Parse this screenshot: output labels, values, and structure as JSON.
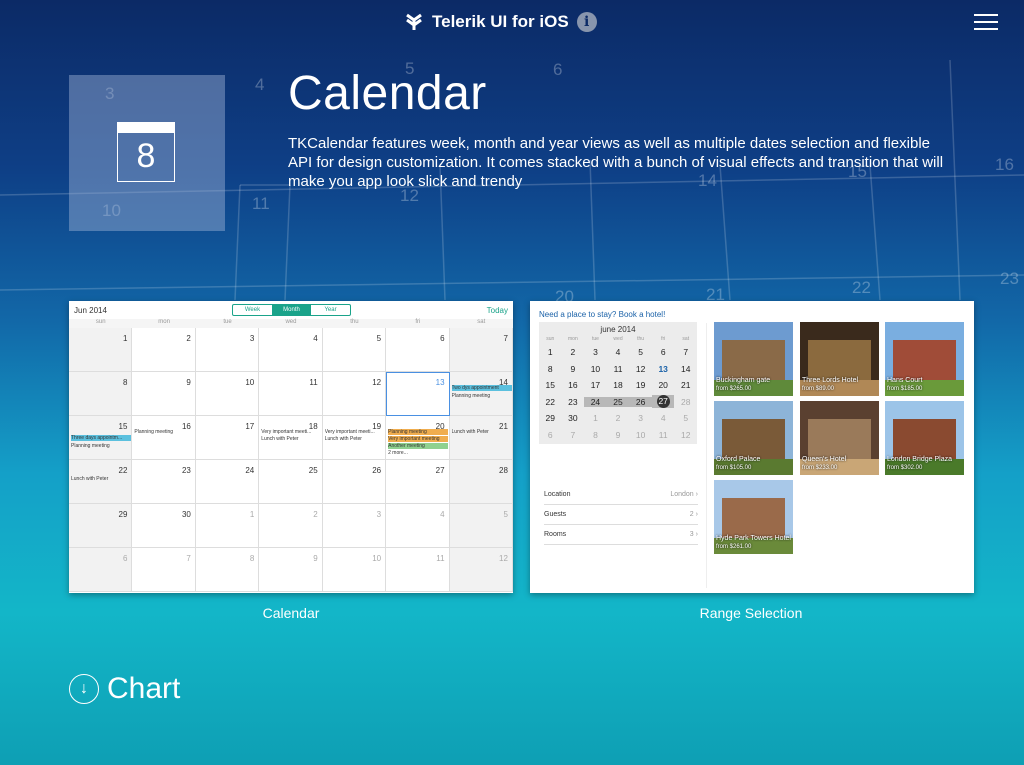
{
  "header": {
    "title": "Telerik UI for iOS",
    "info_glyph": "i"
  },
  "hero": {
    "icon_day": "8",
    "title": "Calendar",
    "description": "TKCalendar features week, month and year views as well as multiple dates selection and flexible API for design customization. It comes stacked with a bunch of visual effects and transition that will make you app look slick and trendy"
  },
  "bg_numbers": [
    "3",
    "4",
    "5",
    "6",
    "10",
    "11",
    "12",
    "14",
    "15",
    "16",
    "21",
    "22",
    "23",
    "20"
  ],
  "month_calendar": {
    "title": "Jun 2014",
    "views": [
      "Week",
      "Month",
      "Year"
    ],
    "active_view": "Month",
    "today_label": "Today",
    "dows": [
      "sun",
      "mon",
      "tue",
      "wed",
      "thu",
      "fri",
      "sat"
    ],
    "weeks": [
      [
        "1",
        "2",
        "3",
        "4",
        "5",
        "6",
        "7"
      ],
      [
        "8",
        "9",
        "10",
        "11",
        "12",
        "13",
        "14"
      ],
      [
        "15",
        "16",
        "17",
        "18",
        "19",
        "20",
        "21"
      ],
      [
        "22",
        "23",
        "24",
        "25",
        "26",
        "27",
        "28"
      ],
      [
        "29",
        "30",
        "1",
        "2",
        "3",
        "4",
        "5"
      ],
      [
        "6",
        "7",
        "8",
        "9",
        "10",
        "11",
        "12"
      ]
    ],
    "events": {
      "two_days": "Two dys appointment",
      "planning": "Planning meeting",
      "three_days": "Three days appointm...",
      "very_important": "Very important meeti...",
      "lunch": "Lunch with Peter",
      "very_important_full": "Very important meeting",
      "another": "Another meeting",
      "more": "2 more..."
    },
    "label": "Calendar"
  },
  "range_selection": {
    "link": "Need a place to stay? Book a hotel!",
    "month": "june 2014",
    "dows": [
      "sun",
      "mon",
      "tue",
      "wed",
      "thu",
      "fri",
      "sat"
    ],
    "weeks": [
      [
        "1",
        "2",
        "3",
        "4",
        "5",
        "6",
        "7"
      ],
      [
        "8",
        "9",
        "10",
        "11",
        "12",
        "13",
        "14"
      ],
      [
        "15",
        "16",
        "17",
        "18",
        "19",
        "20",
        "21"
      ],
      [
        "22",
        "23",
        "24",
        "25",
        "26",
        "27",
        "28"
      ],
      [
        "29",
        "30",
        "1",
        "2",
        "3",
        "4",
        "5"
      ],
      [
        "6",
        "7",
        "8",
        "9",
        "10",
        "11",
        "12"
      ]
    ],
    "fields": [
      {
        "label": "Location",
        "value": "London"
      },
      {
        "label": "Guests",
        "value": "2"
      },
      {
        "label": "Rooms",
        "value": "3"
      }
    ],
    "hotels": [
      {
        "name": "Buckingham gate",
        "price": "from $265.00"
      },
      {
        "name": "Three Lords Hotel",
        "price": "from $89.00"
      },
      {
        "name": "Hans Court",
        "price": "from $185.00"
      },
      {
        "name": "Oxford Palace",
        "price": "from $105.00"
      },
      {
        "name": "Queen's Hotel",
        "price": "from $233.00"
      },
      {
        "name": "London Bridge Plaza",
        "price": "from $302.00"
      },
      {
        "name": "Hyde Park Towers Hotel",
        "price": "from $261.00"
      }
    ],
    "label": "Range Selection"
  },
  "next_section": {
    "label": "Chart"
  }
}
